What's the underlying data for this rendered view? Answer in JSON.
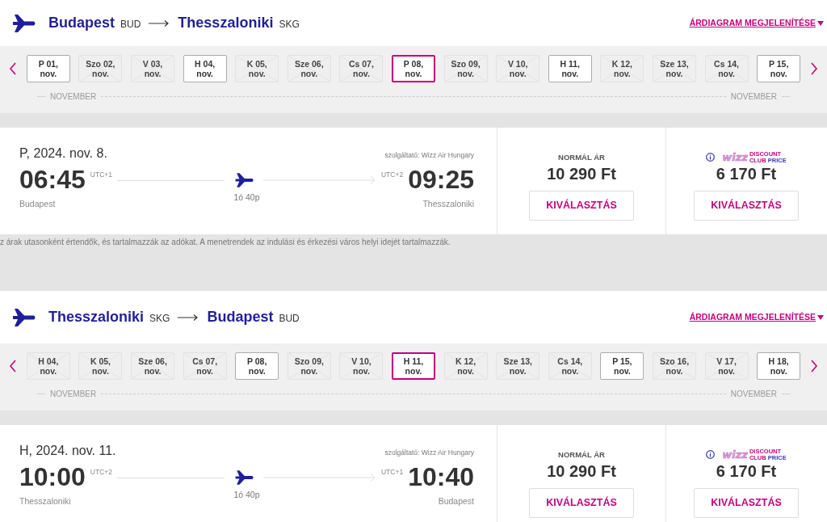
{
  "legs": [
    {
      "origin": {
        "city": "Budapest",
        "code": "BUD"
      },
      "destination": {
        "city": "Thesszaloniki",
        "code": "SKG"
      },
      "price_chart_link": "ÁRDIAGRAM MEGJELENÍTÉSE",
      "dates": [
        {
          "label": "P 01,",
          "month": "nov.",
          "available": true,
          "selected": false
        },
        {
          "label": "Szo 02,",
          "month": "nov.",
          "available": false,
          "selected": false
        },
        {
          "label": "V 03,",
          "month": "nov.",
          "available": false,
          "selected": false
        },
        {
          "label": "H 04,",
          "month": "nov.",
          "available": true,
          "selected": false
        },
        {
          "label": "K 05,",
          "month": "nov.",
          "available": false,
          "selected": false
        },
        {
          "label": "Sze 06,",
          "month": "nov.",
          "available": false,
          "selected": false
        },
        {
          "label": "Cs 07,",
          "month": "nov.",
          "available": false,
          "selected": false
        },
        {
          "label": "P 08,",
          "month": "nov.",
          "available": true,
          "selected": true
        },
        {
          "label": "Szo 09,",
          "month": "nov.",
          "available": false,
          "selected": false
        },
        {
          "label": "V 10,",
          "month": "nov.",
          "available": false,
          "selected": false
        },
        {
          "label": "H 11,",
          "month": "nov.",
          "available": true,
          "selected": false
        },
        {
          "label": "K 12,",
          "month": "nov.",
          "available": false,
          "selected": false
        },
        {
          "label": "Sze 13,",
          "month": "nov.",
          "available": false,
          "selected": false
        },
        {
          "label": "Cs 14,",
          "month": "nov.",
          "available": false,
          "selected": false
        },
        {
          "label": "P 15,",
          "month": "nov.",
          "available": true,
          "selected": false
        }
      ],
      "month_labels": [
        "NOVEMBER",
        "NOVEMBER"
      ],
      "flight": {
        "date": "P, 2024. nov. 8.",
        "carrier": "szolgáltató: Wizz Air Hungary",
        "departure": {
          "time": "06:45",
          "utc": "UTC+1",
          "city": "Budapest"
        },
        "arrival": {
          "time": "09:25",
          "utc": "UTC+2",
          "city": "Thesszaloniki"
        },
        "duration": "1ó 40p",
        "fares": [
          {
            "kind": "normal",
            "label": "NORMÁL ÁR",
            "price": "10 290 Ft",
            "button": "KIVÁLASZTÁS"
          },
          {
            "kind": "club",
            "wordmark": "wizz",
            "line1": "DISCOUNT",
            "line2": [
              "CLUB",
              "PRICE"
            ],
            "price": "6 170 Ft",
            "button": "KIVÁLASZTÁS"
          }
        ]
      },
      "note": "z árak utasonként értendők, és tartalmazzák az adókat. A menetrendek az indulási és érkezési város helyi idejét tartalmazzák."
    },
    {
      "origin": {
        "city": "Thesszaloniki",
        "code": "SKG"
      },
      "destination": {
        "city": "Budapest",
        "code": "BUD"
      },
      "price_chart_link": "ÁRDIAGRAM MEGJELENÍTÉSE",
      "dates": [
        {
          "label": "H 04,",
          "month": "nov.",
          "available": false,
          "selected": false
        },
        {
          "label": "K 05,",
          "month": "nov.",
          "available": false,
          "selected": false
        },
        {
          "label": "Sze 06,",
          "month": "nov.",
          "available": false,
          "selected": false
        },
        {
          "label": "Cs 07,",
          "month": "nov.",
          "available": false,
          "selected": false
        },
        {
          "label": "P 08,",
          "month": "nov.",
          "available": true,
          "selected": false
        },
        {
          "label": "Szo 09,",
          "month": "nov.",
          "available": false,
          "selected": false
        },
        {
          "label": "V 10,",
          "month": "nov.",
          "available": false,
          "selected": false
        },
        {
          "label": "H 11,",
          "month": "nov.",
          "available": true,
          "selected": true
        },
        {
          "label": "K 12,",
          "month": "nov.",
          "available": false,
          "selected": false
        },
        {
          "label": "Sze 13,",
          "month": "nov.",
          "available": false,
          "selected": false
        },
        {
          "label": "Cs 14,",
          "month": "nov.",
          "available": false,
          "selected": false
        },
        {
          "label": "P 15,",
          "month": "nov.",
          "available": true,
          "selected": false
        },
        {
          "label": "Szo 16,",
          "month": "nov.",
          "available": false,
          "selected": false
        },
        {
          "label": "V 17,",
          "month": "nov.",
          "available": false,
          "selected": false
        },
        {
          "label": "H 18,",
          "month": "nov.",
          "available": true,
          "selected": false
        }
      ],
      "month_labels": [
        "NOVEMBER",
        "NOVEMBER"
      ],
      "flight": {
        "date": "H, 2024. nov. 11.",
        "carrier": "szolgáltató: Wizz Air Hungary",
        "departure": {
          "time": "10:00",
          "utc": "UTC+2",
          "city": "Thesszaloniki"
        },
        "arrival": {
          "time": "10:40",
          "utc": "UTC+1",
          "city": "Budapest"
        },
        "duration": "1ó 40p",
        "fares": [
          {
            "kind": "normal",
            "label": "NORMÁL ÁR",
            "price": "10 290 Ft",
            "button": "KIVÁLASZTÁS"
          },
          {
            "kind": "club",
            "wordmark": "wizz",
            "line1": "DISCOUNT",
            "line2": [
              "CLUB",
              "PRICE"
            ],
            "price": "6 170 Ft",
            "button": "KIVÁLASZTÁS"
          }
        ]
      }
    }
  ]
}
